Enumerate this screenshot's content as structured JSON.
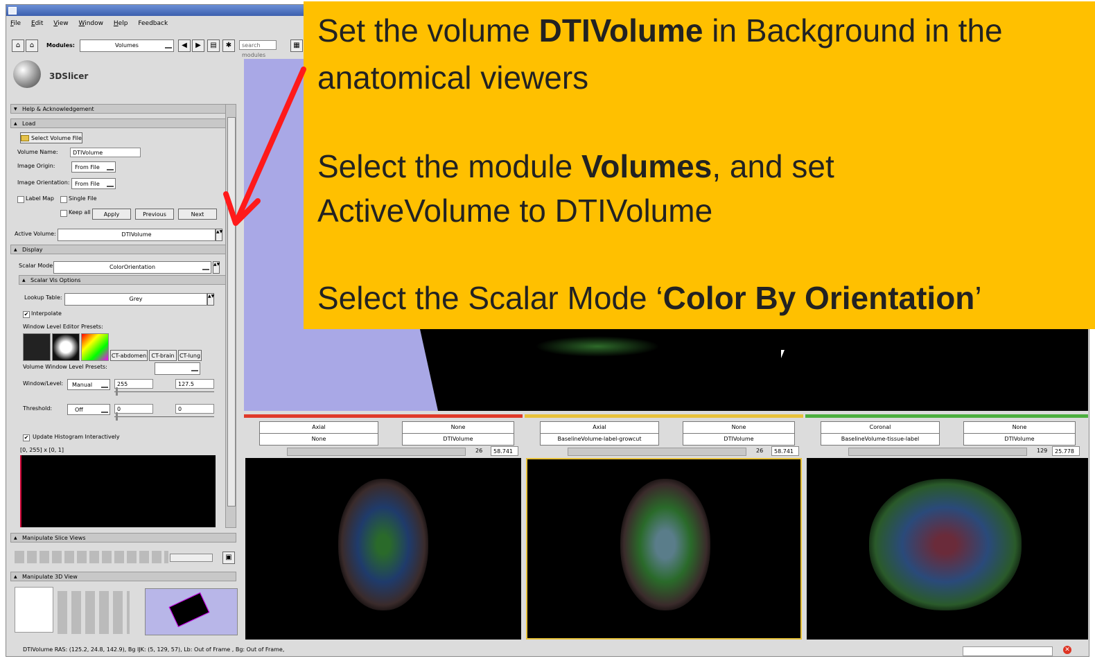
{
  "menu": [
    "File",
    "Edit",
    "View",
    "Window",
    "Help",
    "Feedback"
  ],
  "toolbar": {
    "modules_label": "Modules:",
    "module_value": "Volumes",
    "search_placeholder": "search modules"
  },
  "logo_text": "3DSlicer",
  "sections": {
    "help": "Help & Acknowledgement",
    "load": "Load",
    "display": "Display",
    "scalar_vis": "Scalar Vis Options",
    "manip_slice": "Manipulate Slice Views",
    "manip_3d": "Manipulate 3D View"
  },
  "load": {
    "select_file_label": "Select Volume File",
    "volume_name_label": "Volume Name:",
    "volume_name_value": "DTIVolume",
    "image_origin_label": "Image Origin:",
    "image_origin_value": "From File",
    "image_orientation_label": "Image Orientation:",
    "image_orientation_value": "From File",
    "label_map_label": "Label Map",
    "single_file_label": "Single File",
    "keep_all_label": "Keep all",
    "apply_label": "Apply",
    "previous_label": "Previous",
    "next_label": "Next"
  },
  "active_volume": {
    "label": "Active Volume:",
    "value": "DTIVolume"
  },
  "display": {
    "scalar_mode_label": "Scalar Mode",
    "scalar_mode_value": "ColorOrientation",
    "lookup_label": "Lookup Table:",
    "lookup_value": "Grey",
    "interpolate_label": "Interpolate",
    "wl_presets_label": "Window Level Editor Presets:",
    "presets": [
      "CT-abdomen",
      "CT-brain",
      "CT-lung"
    ],
    "vol_wl_presets_label": "Volume Window Level Presets:",
    "window_level_label": "Window/Level:",
    "window_level_mode": "Manual",
    "window_value": "255",
    "level_value": "127.5",
    "threshold_label": "Threshold:",
    "threshold_mode": "Off",
    "threshold_min": "0",
    "threshold_max": "0",
    "update_hist_label": "Update Histogram Interactively",
    "hist_range": "[0, 255] x [0, 1]"
  },
  "overlay": {
    "line1_a": "Set the volume ",
    "line1_b": "DTIVolume",
    "line1_c": " in Background in the",
    "line2": "anatomical viewers",
    "line3_a": "Select the module ",
    "line3_b": "Volumes",
    "line3_c": ", and set",
    "line4": "ActiveVolume to DTIVolume",
    "line5_a": "Select the Scalar Mode ‘",
    "line5_b": "Color By Orientation",
    "line5_c": "’"
  },
  "slice_views": [
    {
      "color": "#e03a2a",
      "orientation": "Axial",
      "fg": "None",
      "label": "None",
      "bg": "DTIVolume",
      "slice_num": "26",
      "offset": "58.741"
    },
    {
      "color": "#e8c23a",
      "orientation": "Axial",
      "fg": "None",
      "label": "BaselineVolume-label-growcut",
      "bg": "DTIVolume",
      "slice_num": "26",
      "offset": "58.741"
    },
    {
      "color": "#4caf3f",
      "orientation": "Coronal",
      "fg": "None",
      "label": "BaselineVolume-tissue-label",
      "bg": "DTIVolume",
      "slice_num": "129",
      "offset": "25.778"
    }
  ],
  "status_text": "DTIVolume RAS: (125.2, 24.8, 142.9), Bg IJK: (5, 129, 57), Lb: Out of Frame , Bg: Out of Frame,",
  "colors": {
    "overlay_bg": "#ffc000",
    "arrow": "#ff1a1a",
    "panel": "#dcdcdc"
  }
}
